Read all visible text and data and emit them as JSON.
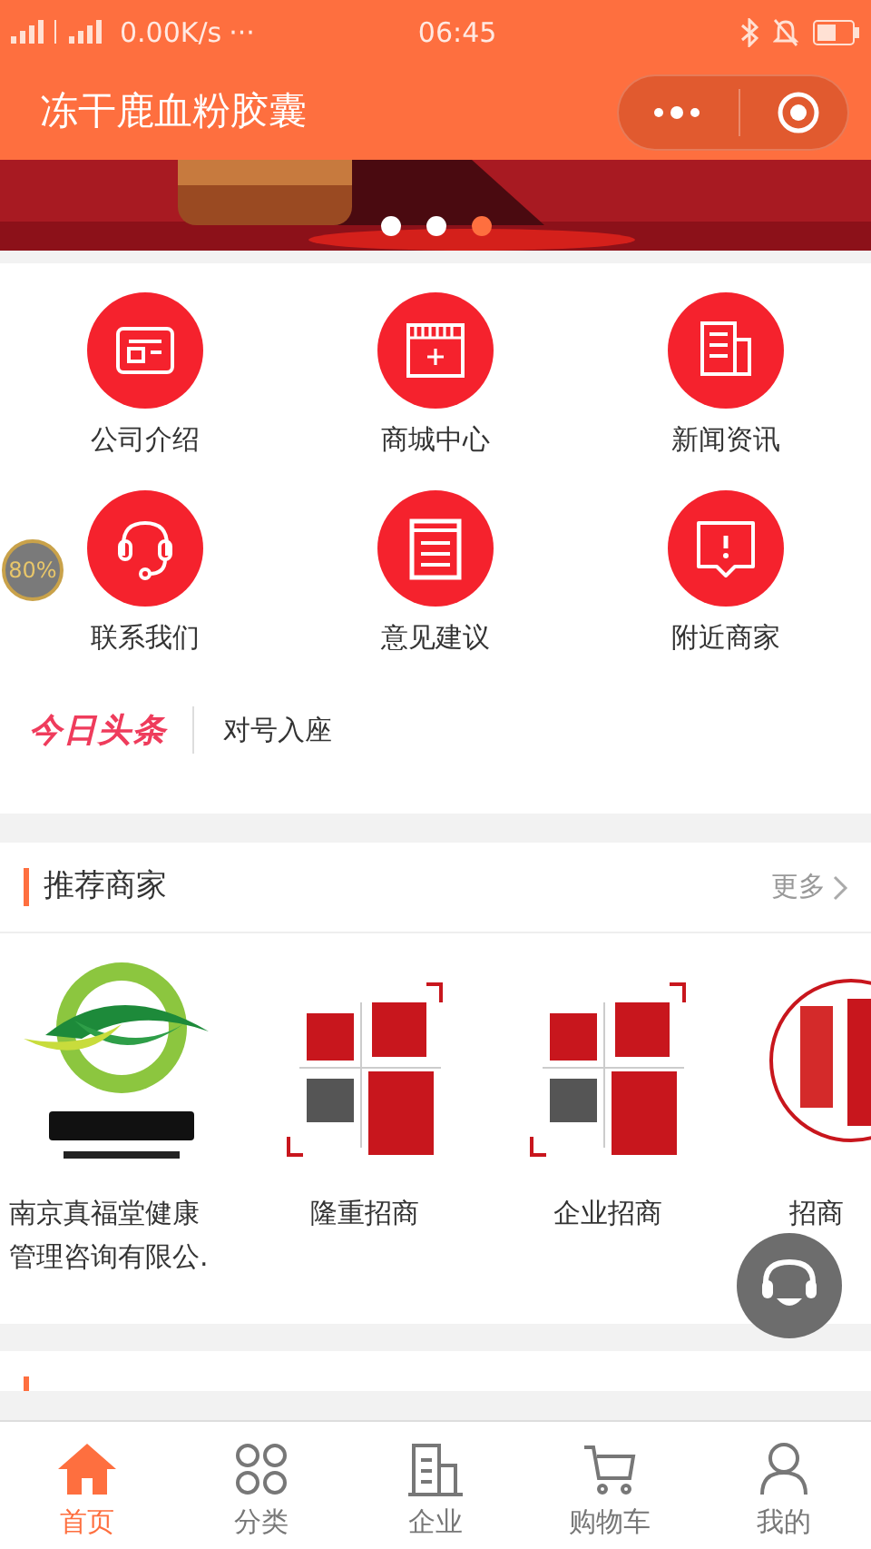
{
  "status_bar": {
    "network_speed": "0.00K/s",
    "more": "···",
    "time": "06:45"
  },
  "header": {
    "title": "冻干鹿血粉胶囊"
  },
  "banner": {
    "dots": [
      {
        "selected": false
      },
      {
        "selected": false
      },
      {
        "selected": true
      }
    ]
  },
  "shortcuts": [
    {
      "label": "公司介绍"
    },
    {
      "label": "商城中心"
    },
    {
      "label": "新闻资讯"
    },
    {
      "label": "联系我们"
    },
    {
      "label": "意见建议"
    },
    {
      "label": "附近商家"
    }
  ],
  "float_badge": "80%",
  "headline": {
    "logo": "今日头条",
    "text": "对号入座"
  },
  "merchants_section": {
    "title": "推荐商家",
    "more": "更多",
    "items": [
      {
        "name": "南京真福堂健康管理咨询有限公."
      },
      {
        "name": "隆重招商"
      },
      {
        "name": "企业招商"
      },
      {
        "name": "招商"
      }
    ]
  },
  "tab_bar": [
    {
      "label": "首页",
      "selected": true
    },
    {
      "label": "分类",
      "selected": false
    },
    {
      "label": "企业",
      "selected": false
    },
    {
      "label": "购物车",
      "selected": false
    },
    {
      "label": "我的",
      "selected": false
    }
  ]
}
